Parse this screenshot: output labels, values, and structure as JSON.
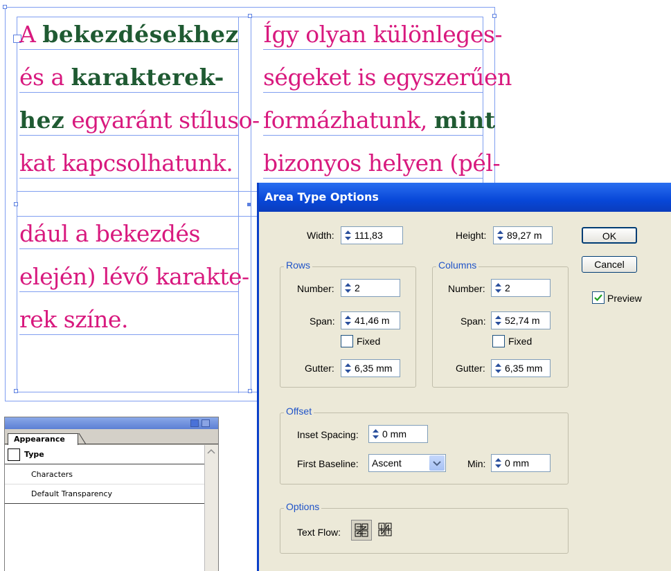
{
  "canvas": {
    "left_column": [
      {
        "parts": [
          {
            "t": "A ",
            "g": false
          },
          {
            "t": "bekezdésekhez",
            "g": true
          }
        ]
      },
      {
        "parts": [
          {
            "t": "és a ",
            "g": false
          },
          {
            "t": "karakterek-",
            "g": true
          }
        ]
      },
      {
        "parts": [
          {
            "t": "hez",
            "g": true
          },
          {
            "t": " egyaránt stíluso-",
            "g": false
          }
        ]
      },
      {
        "parts": [
          {
            "t": "kat kapcsolhatunk.",
            "g": false
          }
        ]
      }
    ],
    "right_column": [
      {
        "parts": [
          {
            "t": "Így olyan különleges-",
            "g": false
          }
        ]
      },
      {
        "parts": [
          {
            "t": "ségeket is egyszerűen",
            "g": false
          }
        ]
      },
      {
        "parts": [
          {
            "t": "formázhatunk, ",
            "g": false
          },
          {
            "t": "mint",
            "g": true
          }
        ]
      },
      {
        "parts": [
          {
            "t": "bizonyos helyen (pél-",
            "g": false
          }
        ]
      }
    ],
    "lower_left": [
      {
        "parts": [
          {
            "t": "dául a bekezdés",
            "g": false
          }
        ]
      },
      {
        "parts": [
          {
            "t": "elején) lévő karakte-",
            "g": false
          }
        ]
      },
      {
        "parts": [
          {
            "t": "rek színe.",
            "g": false
          }
        ]
      }
    ]
  },
  "appearance_panel": {
    "tab_label": "Appearance",
    "rows": [
      {
        "label": "Type",
        "bold": true
      },
      {
        "label": "Characters",
        "bold": false
      },
      {
        "label": "Default Transparency",
        "bold": false
      }
    ]
  },
  "dialog": {
    "title": "Area Type Options",
    "width_label": "Width:",
    "width_value": "111,83",
    "height_label": "Height:",
    "height_value": "89,27 m",
    "rows": {
      "title": "Rows",
      "number_label": "Number:",
      "number_value": "2",
      "span_label": "Span:",
      "span_value": "41,46 m",
      "fixed_label": "Fixed",
      "fixed_checked": false,
      "gutter_label": "Gutter:",
      "gutter_value": "6,35 mm"
    },
    "columns": {
      "title": "Columns",
      "number_label": "Number:",
      "number_value": "2",
      "span_label": "Span:",
      "span_value": "52,74 m",
      "fixed_label": "Fixed",
      "fixed_checked": false,
      "gutter_label": "Gutter:",
      "gutter_value": "6,35 mm"
    },
    "offset": {
      "title": "Offset",
      "inset_label": "Inset Spacing:",
      "inset_value": "0 mm",
      "baseline_label": "First Baseline:",
      "baseline_value": "Ascent",
      "min_label": "Min:",
      "min_value": "0 mm"
    },
    "options": {
      "title": "Options",
      "text_flow_label": "Text Flow:"
    },
    "ok_label": "OK",
    "cancel_label": "Cancel",
    "preview_label": "Preview",
    "preview_checked": true
  },
  "colors": {
    "text_magenta": "#d8197e",
    "text_green": "#1f5a32",
    "guide_blue": "#7f9ef0",
    "dialog_title_blue": "#0847d8",
    "group_title_blue": "#1f53c8",
    "dialog_bg": "#ece9d8"
  }
}
